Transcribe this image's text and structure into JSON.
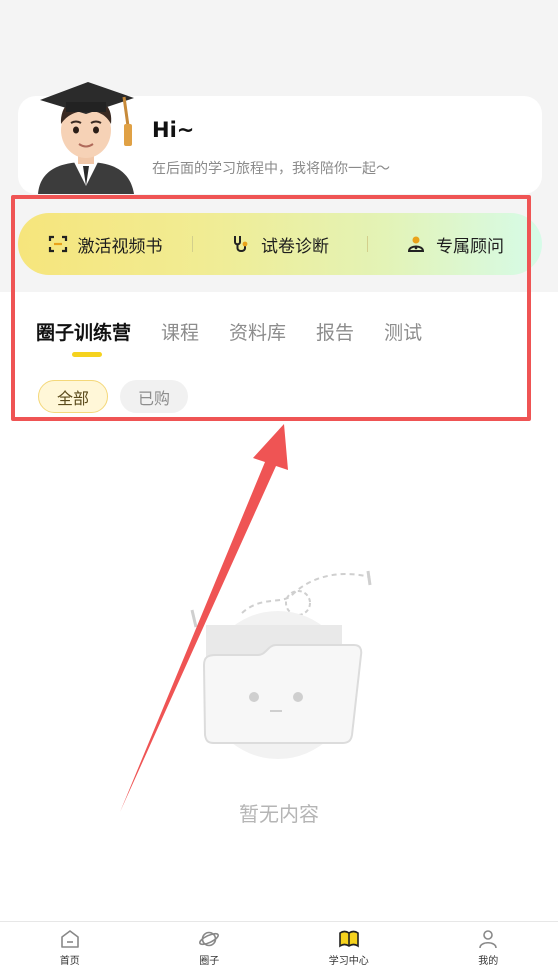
{
  "greeting": {
    "title": "Hi~",
    "subtitle": "在后面的学习旅程中，我将陪你一起～"
  },
  "quick_actions": [
    {
      "label": "激活视频书",
      "icon": "scan-icon"
    },
    {
      "label": "试卷诊断",
      "icon": "stethoscope-icon"
    },
    {
      "label": "专属顾问",
      "icon": "advisor-icon"
    }
  ],
  "tabs": [
    {
      "label": "圈子训练营",
      "active": true
    },
    {
      "label": "课程",
      "active": false
    },
    {
      "label": "资料库",
      "active": false
    },
    {
      "label": "报告",
      "active": false
    },
    {
      "label": "测试",
      "active": false
    }
  ],
  "filters": [
    {
      "label": "全部",
      "active": true
    },
    {
      "label": "已购",
      "active": false
    }
  ],
  "empty_state": {
    "text": "暂无内容"
  },
  "bottom_nav": [
    {
      "label": "首页",
      "icon": "home-icon"
    },
    {
      "label": "圈子",
      "icon": "planet-icon"
    },
    {
      "label": "学习中心",
      "icon": "book-icon",
      "active": true
    },
    {
      "label": "我的",
      "icon": "user-icon"
    }
  ],
  "colors": {
    "accent": "#f5d21e",
    "annotation": "#ef5454"
  }
}
